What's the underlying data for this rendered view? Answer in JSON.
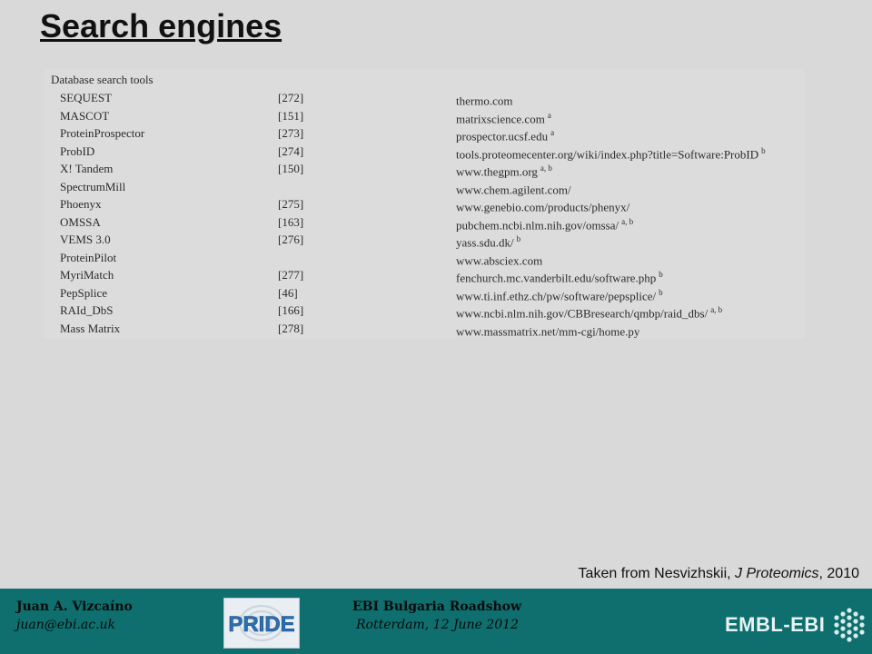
{
  "slide": {
    "title": "Search engines",
    "citation": {
      "prefix": "Taken from Nesvizhskii, ",
      "journal": "J Proteomics",
      "suffix": ", 2010"
    }
  },
  "table": {
    "heading": "Database search tools",
    "rows": [
      {
        "name": "SEQUEST",
        "ref": "[272]",
        "url": "thermo.com",
        "notes": ""
      },
      {
        "name": "MASCOT",
        "ref": "[151]",
        "url": "matrixscience.com",
        "notes": "a"
      },
      {
        "name": "ProteinProspector",
        "ref": "[273]",
        "url": "prospector.ucsf.edu",
        "notes": "a"
      },
      {
        "name": "ProbID",
        "ref": "[274]",
        "url": "tools.proteomecenter.org/wiki/index.php?title=Software:ProbID",
        "notes": "b"
      },
      {
        "name": "X! Tandem",
        "ref": "[150]",
        "url": "www.thegpm.org",
        "notes": "a, b"
      },
      {
        "name": "SpectrumMill",
        "ref": "",
        "url": "www.chem.agilent.com/",
        "notes": ""
      },
      {
        "name": "Phoenyx",
        "ref": "[275]",
        "url": "www.genebio.com/products/phenyx/",
        "notes": ""
      },
      {
        "name": "OMSSA",
        "ref": "[163]",
        "url": "pubchem.ncbi.nlm.nih.gov/omssa/",
        "notes": "a, b"
      },
      {
        "name": "VEMS 3.0",
        "ref": "[276]",
        "url": "yass.sdu.dk/",
        "notes": "b"
      },
      {
        "name": "ProteinPilot",
        "ref": "",
        "url": "www.absciex.com",
        "notes": ""
      },
      {
        "name": "MyriMatch",
        "ref": "[277]",
        "url": "fenchurch.mc.vanderbilt.edu/software.php",
        "notes": "b"
      },
      {
        "name": "PepSplice",
        "ref": "[46]",
        "url": "www.ti.inf.ethz.ch/pw/software/pepsplice/",
        "notes": "b"
      },
      {
        "name": "RAId_DbS",
        "ref": "[166]",
        "url": "www.ncbi.nlm.nih.gov/CBBresearch/qmbp/raid_dbs/",
        "notes": "a, b"
      },
      {
        "name": "Mass Matrix",
        "ref": "[278]",
        "url": "www.massmatrix.net/mm-cgi/home.py",
        "notes": ""
      }
    ]
  },
  "footer": {
    "author_name": "Juan A. Vizcaíno",
    "author_email": "juan@ebi.ac.uk",
    "pride_logo_text": "PRIDE",
    "event_name": "EBI Bulgaria Roadshow",
    "event_place_date": "Rotterdam, 12 June 2012",
    "embl_logo_text": "EMBL-EBI"
  },
  "colors": {
    "background": "#d9d9d9",
    "footer": "#0e6f6e",
    "pride_blue": "#2e6fb0"
  }
}
